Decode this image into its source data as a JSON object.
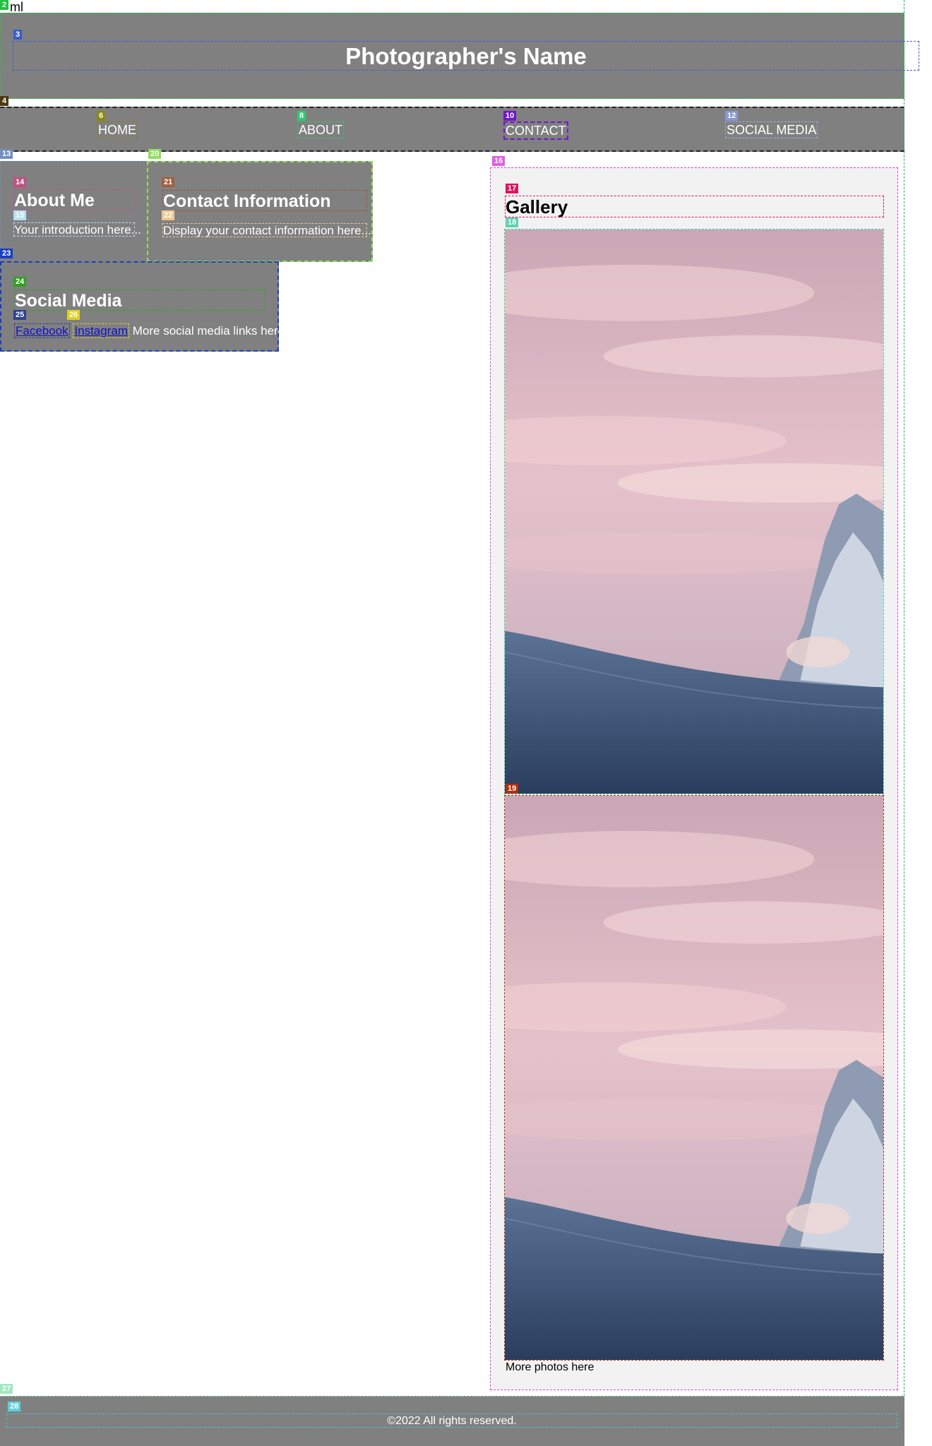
{
  "stray_text": "ml",
  "header": {
    "title": "Photographer's Name"
  },
  "nav": {
    "items": [
      {
        "label": "HOME"
      },
      {
        "label": "ABOUT"
      },
      {
        "label": "CONTACT"
      },
      {
        "label": "SOCIAL MEDIA"
      }
    ]
  },
  "about": {
    "heading": "About Me",
    "text": "Your introduction here..."
  },
  "contact": {
    "heading": "Contact Information",
    "text": "Display your contact information here..."
  },
  "social": {
    "heading": "Social Media",
    "links": [
      {
        "label": "Facebook"
      },
      {
        "label": "Instagram"
      }
    ],
    "more_text": "More social media links here"
  },
  "gallery": {
    "heading": "Gallery",
    "photos": [
      {
        "subject": "snowy mountain peak at sunset with pink clouds"
      },
      {
        "subject": "snowy mountain peak at sunset with pink clouds"
      }
    ],
    "more_text": "More photos here"
  },
  "footer": {
    "copyright": "©2022 All rights reserved."
  },
  "annotation_labels": [
    "2",
    "3",
    "4",
    "6",
    "8",
    "10",
    "12",
    "13",
    "14",
    "15",
    "16",
    "17",
    "18",
    "19",
    "20",
    "21",
    "22",
    "23",
    "24",
    "25",
    "26",
    "27",
    "28"
  ],
  "colors": {
    "panel_gray": "#808080",
    "gallery_bg": "#f2f2f2",
    "link_blue": "#1010c8"
  }
}
